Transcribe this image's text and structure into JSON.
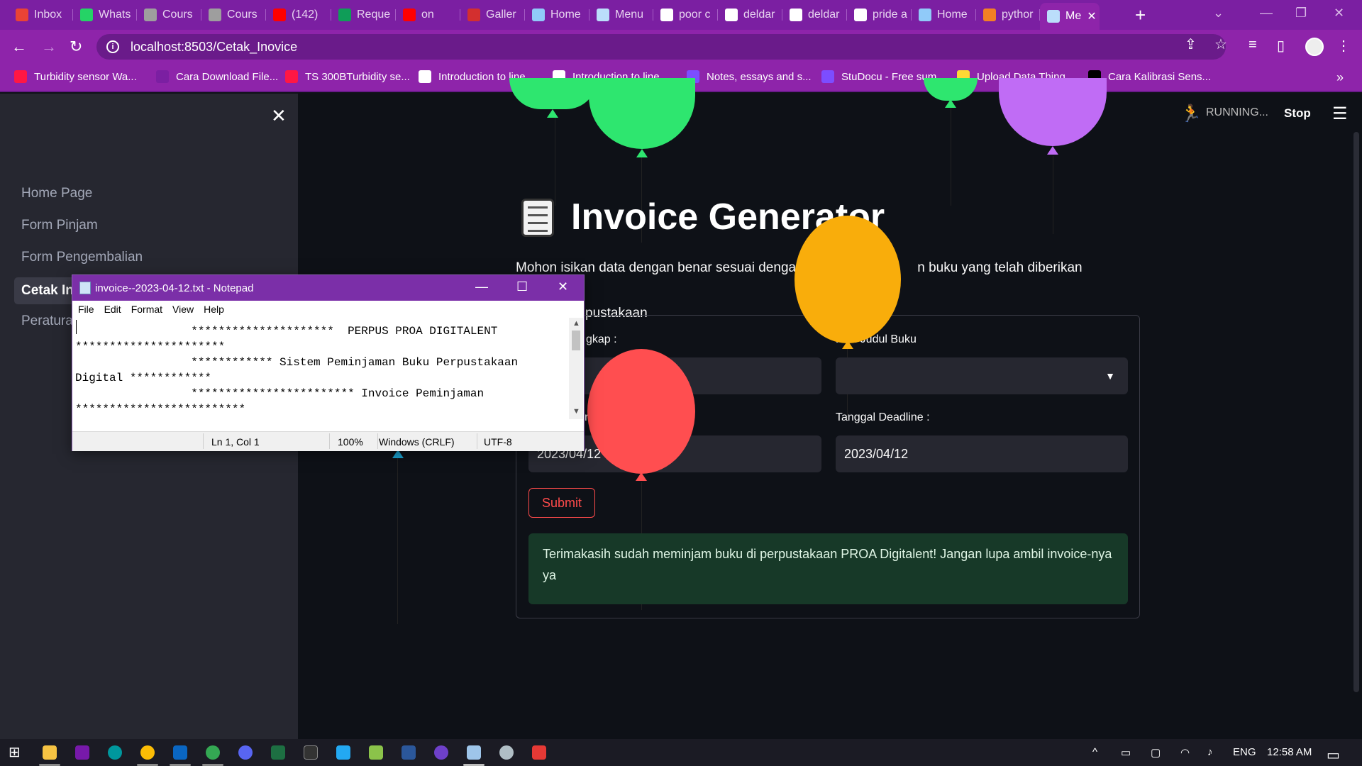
{
  "browser": {
    "tabs": [
      {
        "label": "Inbox",
        "icon": "gmail-icon",
        "color": "#ea4335"
      },
      {
        "label": "Whats",
        "icon": "whatsapp-icon",
        "color": "#25d366"
      },
      {
        "label": "Cours",
        "icon": "cisco-icon",
        "color": "#9e9e9e"
      },
      {
        "label": "Cours",
        "icon": "cisco-icon",
        "color": "#9e9e9e"
      },
      {
        "label": "(142)",
        "icon": "youtube-icon",
        "color": "#ff0000"
      },
      {
        "label": "Reque",
        "icon": "plus-icon",
        "color": "#0f9d58"
      },
      {
        "label": "on",
        "icon": "youtube-music-icon",
        "color": "#ff0000"
      },
      {
        "label": "Galler",
        "icon": "crown-icon",
        "color": "#d32f2f"
      },
      {
        "label": "Home",
        "icon": "page-icon",
        "color": "#90caf9"
      },
      {
        "label": "Menu",
        "icon": "book-icon",
        "color": "#bbdefb"
      },
      {
        "label": "poor c",
        "icon": "google-icon",
        "color": "#ffffff"
      },
      {
        "label": "deldar",
        "icon": "github-icon",
        "color": "#ffffff"
      },
      {
        "label": "deldar",
        "icon": "github-icon",
        "color": "#ffffff"
      },
      {
        "label": "pride a",
        "icon": "google-icon",
        "color": "#ffffff"
      },
      {
        "label": "Home",
        "icon": "page-icon",
        "color": "#90caf9"
      },
      {
        "label": "pythor",
        "icon": "stackoverflow-icon",
        "color": "#f48024"
      },
      {
        "label": "Me",
        "icon": "notepad-icon",
        "color": "#bbdefb"
      }
    ],
    "url": "localhost:8503/Cetak_Inovice",
    "bookmarks": [
      {
        "label": "Turbidity sensor Wa...",
        "color": "#ff1744"
      },
      {
        "label": "Cara Download File...",
        "color": "#7b1fa2"
      },
      {
        "label": "TS 300BTurbidity se...",
        "color": "#ff1744"
      },
      {
        "label": "Introduction to line...",
        "color": "#ffffff"
      },
      {
        "label": "Introduction to line...",
        "color": "#ffffff"
      },
      {
        "label": "Notes, essays and s...",
        "color": "#7c4dff"
      },
      {
        "label": "StuDocu - Free sum...",
        "color": "#7c4dff"
      },
      {
        "label": "Upload Data Thing...",
        "color": "#fdd835"
      },
      {
        "label": "Cara Kalibrasi Sens...",
        "color": "#000000"
      }
    ],
    "bookmarks_more": "»"
  },
  "app": {
    "status": "RUNNING...",
    "stop_label": "Stop",
    "sidebar": {
      "items": [
        "Home Page",
        "Form Pinjam",
        "Form Pengembalian",
        "Cetak In",
        "Peratura"
      ],
      "active_index": 3
    },
    "title": "Invoice Generator",
    "subtitle": "Mohon isikan data dengan benar sesuai dengan                    n buku yang telah diberikan oleh                    pustakaan",
    "subtitle_line1_a": "Mohon isikan data dengan benar sesuai dengan",
    "subtitle_line1_b": "n buku yang telah diberikan oleh",
    "subtitle_line2": "pustakaan",
    "form": {
      "name_label": "gkap :",
      "book_label": "Pilih Judul Buku",
      "book_label_visible": "Pi  h Judul Buku",
      "borrow_date_label_fragment": "r",
      "deadline_label": "Tanggal Deadline :",
      "borrow_date_value": "2023/04/12",
      "deadline_value": "2023/04/12",
      "submit_label": "Submit"
    },
    "success_message": "Terimakasih sudah meminjam buku di perpustakaan PROA Digitalent! Jangan lupa ambil invoice-nya ya"
  },
  "balloon_colors": [
    "#2ee66f",
    "#2ee66f",
    "#c06cf5",
    "#f9ad0b",
    "#ff4e50",
    "#2ee66f"
  ],
  "notepad": {
    "title": "invoice--2023-04-12.txt - Notepad",
    "menu": [
      "File",
      "Edit",
      "Format",
      "View",
      "Help"
    ],
    "text": "                 *********************  PERPUS PROA DIGITALENT\n**********************\n                 ************ Sistem Peminjaman Buku Perpustakaan\nDigital ************\n                 ************************ Invoice Peminjaman\n*************************",
    "status": {
      "position": "Ln 1, Col 1",
      "zoom": "100%",
      "line_ending": "Windows (CRLF)",
      "encoding": "UTF-8"
    }
  },
  "taskbar": {
    "language": "ENG",
    "time": "12:58 AM"
  }
}
